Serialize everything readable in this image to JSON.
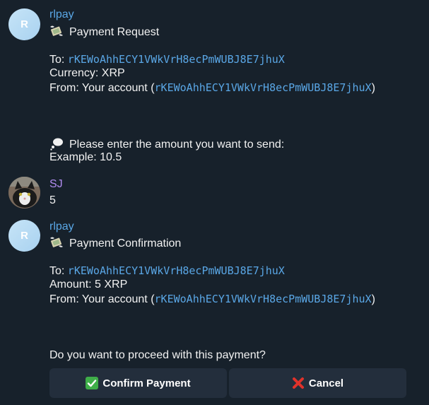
{
  "messages": [
    {
      "sender": "rlpay",
      "avatar_letter": "R",
      "title_emoji": "money-with-wings-icon",
      "title": "Payment Request",
      "to_label": "To: ",
      "to_address": "rKEWoAhhECY1VWkVrH8ecPmWUBJ8E7jhuX",
      "currency_line": "Currency: XRP",
      "from_label": "From: Your account (",
      "from_address": "rKEWoAhhECY1VWkVrH8ecPmWUBJ8E7jhuX",
      "from_close": ")",
      "prompt_emoji": "thought-balloon-icon",
      "prompt": "Please enter the amount you want to send:",
      "example": "Example: 10.5"
    },
    {
      "sender": "SJ",
      "avatar": "cat-avatar",
      "text": "5"
    },
    {
      "sender": "rlpay",
      "avatar_letter": "R",
      "title_emoji": "money-with-wings-icon",
      "title": "Payment Confirmation",
      "to_label": "To: ",
      "to_address": "rKEWoAhhECY1VWkVrH8ecPmWUBJ8E7jhuX",
      "amount_line": "Amount: 5 XRP",
      "from_label": "From: Your account (",
      "from_address": "rKEWoAhhECY1VWkVrH8ecPmWUBJ8E7jhuX",
      "from_close": ")",
      "question": "Do you want to proceed with this payment?"
    }
  ],
  "buttons": {
    "confirm": {
      "icon": "check-mark-button-icon",
      "label": "Confirm Payment"
    },
    "cancel": {
      "icon": "cross-mark-icon",
      "label": "Cancel"
    }
  },
  "colors": {
    "background": "#17212b",
    "link": "#5aa7e6",
    "user_name": "#b18cf0",
    "button_bg": "#232e3c"
  }
}
